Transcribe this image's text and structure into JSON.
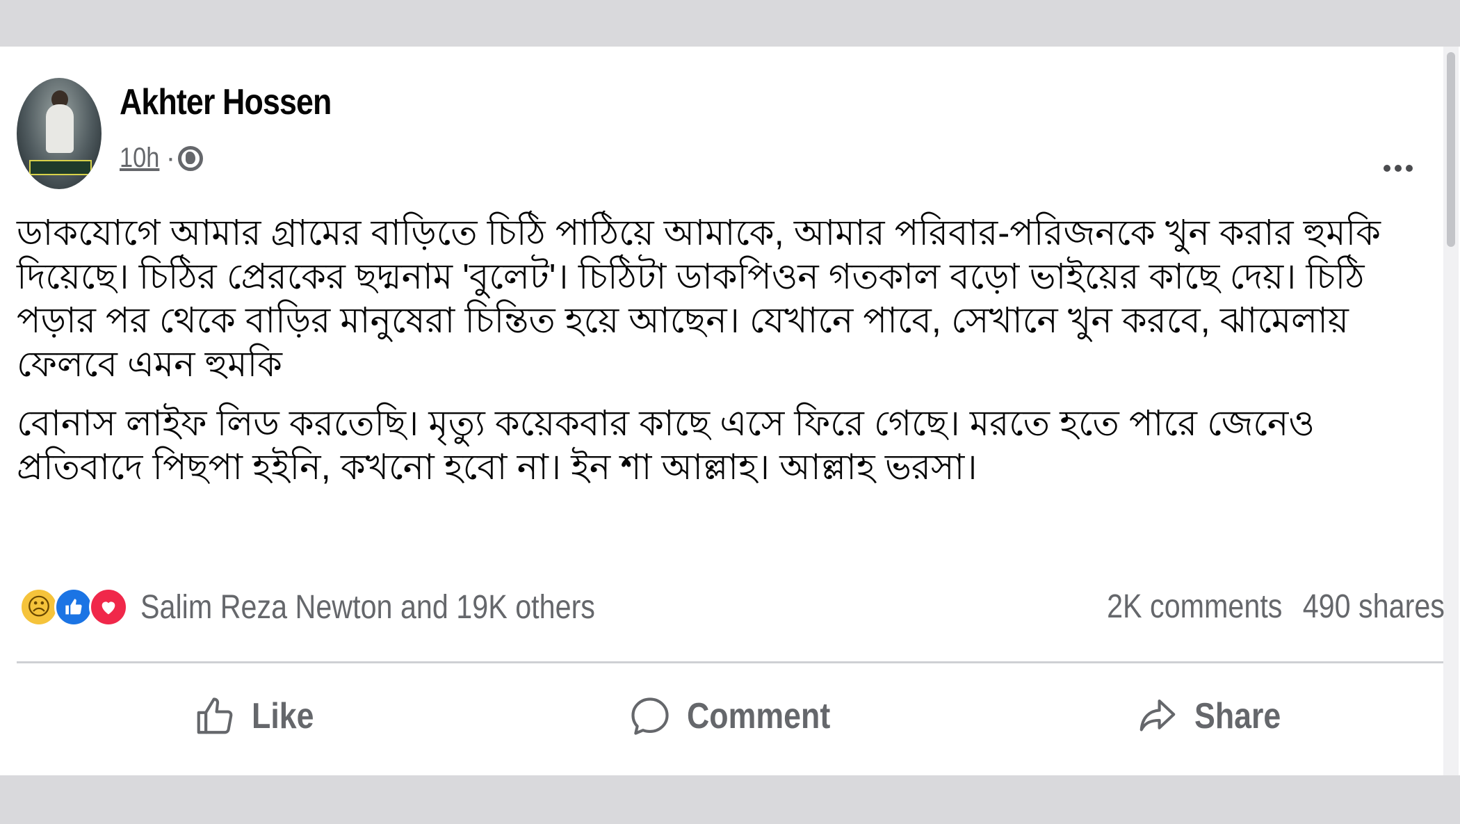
{
  "post": {
    "author": "Akhter Hossen",
    "time": "10h",
    "separator": "·",
    "privacy_icon": "globe-icon",
    "more_icon": "more-horizontal-icon",
    "paragraphs": [
      "ডাকযোগে আমার গ্রামের বাড়িতে চিঠি পাঠিয়ে আমাকে, আমার পরিবার-পরিজনকে খুন করার হুমকি দিয়েছে। চিঠির প্রেরকের ছদ্মনাম 'বুলেট'। চিঠিটা ডাকপিওন গতকাল বড়ো ভাইয়ের কাছে দেয়। চিঠি পড়ার পর থেকে বাড়ির মানুষেরা চিন্তিত হয়ে আছেন। যেখানে পাবে, সেখানে খুন করবে, ঝামেলায় ফেলবে এমন হুমকি",
      "বোনাস লাইফ লিড করতেছি। মৃত্যু কয়েকবার কাছে এসে ফিরে গেছে। মরতে হতে পারে জেনেও প্রতিবাদে পিছপা হইনি, কখনো হবো না। ইন শা আল্লাহ। আল্লাহ ভরসা।"
    ]
  },
  "reactions": {
    "icons": [
      "sad-reaction-icon",
      "like-reaction-icon",
      "love-reaction-icon"
    ],
    "summary": "Salim Reza Newton and 19K others"
  },
  "stats": {
    "comments": "2K comments",
    "shares": "490 shares"
  },
  "actions": {
    "like": "Like",
    "comment": "Comment",
    "share": "Share"
  },
  "colors": {
    "text": "#050505",
    "secondary": "#65676b",
    "like_blue": "#1b74e4",
    "love_red": "#f0284a",
    "sad_yellow": "#f5c33b"
  }
}
